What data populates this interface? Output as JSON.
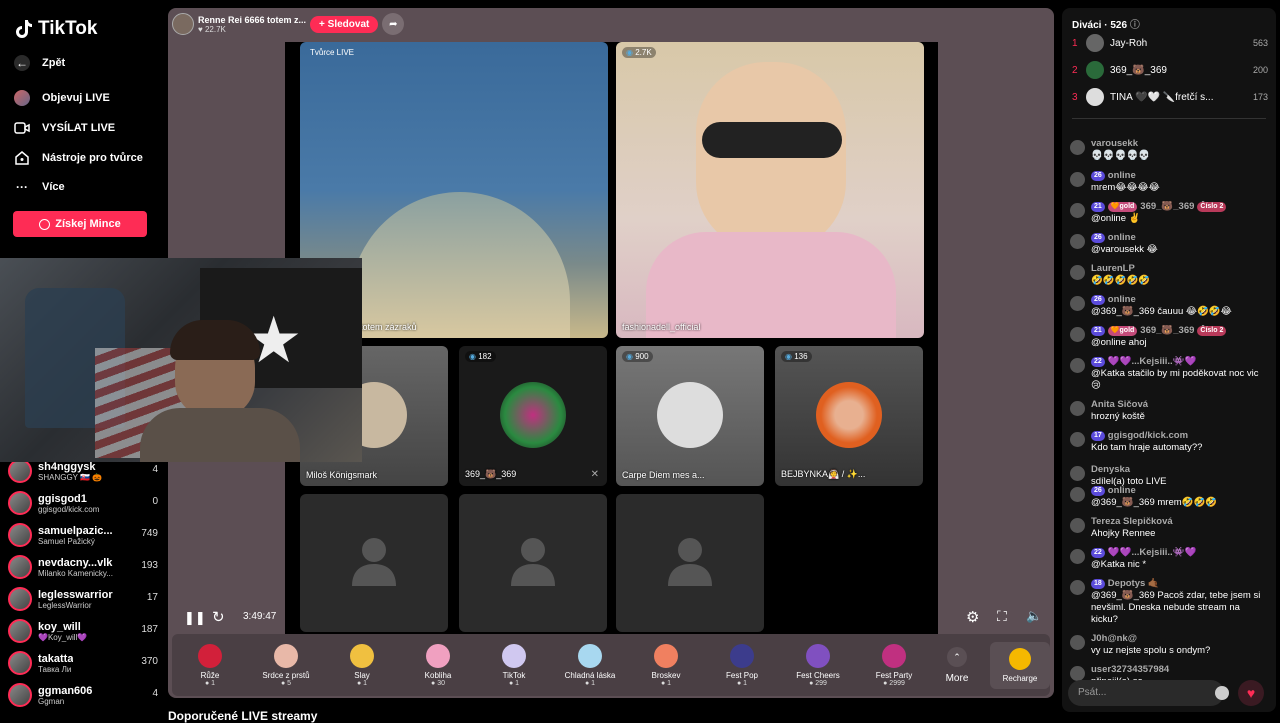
{
  "app": {
    "brand": "TikTok"
  },
  "nav": {
    "back": "Zpět",
    "items": [
      {
        "label": "Objevuj LIVE",
        "icon": "avatar"
      },
      {
        "label": "VYSÍLAT LIVE",
        "icon": "video-icon"
      },
      {
        "label": "Nástroje pro tvůrce",
        "icon": "home-icon"
      },
      {
        "label": "Více",
        "icon": "more-icon"
      }
    ],
    "coins_label": "Získej Mince"
  },
  "accounts": [
    {
      "name": "sh4nggysk",
      "sub": "SHANGGY 🇸🇰 🎃",
      "count": "4"
    },
    {
      "name": "ggisgod1",
      "sub": "ggisgod/kick.com",
      "count": "0"
    },
    {
      "name": "samuelpazic...",
      "sub": "Samuel Pažický",
      "count": "749"
    },
    {
      "name": "nevdacny...vlk",
      "sub": "Milanko Kamenicky...",
      "count": "193"
    },
    {
      "name": "leglesswarrior",
      "sub": "LeglessWarrior",
      "count": "17"
    },
    {
      "name": "koy_will",
      "sub": "💜Koy_will💜",
      "count": "187"
    },
    {
      "name": "takatta",
      "sub": "Тавка Ли",
      "count": "370"
    },
    {
      "name": "ggman606",
      "sub": "Ggman",
      "count": "4"
    }
  ],
  "host": {
    "name": "Renne Rei 6666 totem z...",
    "likes": "♥ 22.7K",
    "follow": "+ Sledovat"
  },
  "tiles": {
    "creator_badge": "Tvůrce LIVE",
    "creator_caption": "totem zázraků",
    "guest1_count": "2.7K",
    "guest1_name": "fashionadell_official",
    "small": [
      {
        "count": "",
        "name": "Miloš Königsmark"
      },
      {
        "count": "182",
        "name": "369_🐻_369"
      },
      {
        "count": "900",
        "name": "Carpe Diem mes a..."
      },
      {
        "count": "136",
        "name": "BEJBYNKA👰 / ✨..."
      }
    ]
  },
  "player": {
    "time": "3:49:47"
  },
  "gifts": [
    {
      "name": "Růže",
      "cost": "1",
      "color": "#d2203a"
    },
    {
      "name": "Srdce z prstů",
      "cost": "5",
      "color": "#e8b8a8"
    },
    {
      "name": "Slay",
      "cost": "1",
      "color": "#f0c040"
    },
    {
      "name": "Kobliha",
      "cost": "30",
      "color": "#f0a0c0"
    },
    {
      "name": "TikTok",
      "cost": "1",
      "color": "#d0c8f0"
    },
    {
      "name": "Chladná láska",
      "cost": "1",
      "color": "#a8d8f0"
    },
    {
      "name": "Broskev",
      "cost": "1",
      "color": "#f08060"
    },
    {
      "name": "Fest Pop",
      "cost": "1",
      "color": "#3c3c8c"
    },
    {
      "name": "Fest Cheers",
      "cost": "299",
      "color": "#8050c0"
    },
    {
      "name": "Fest Party",
      "cost": "2999",
      "color": "#c03080"
    }
  ],
  "gifts_more": "More",
  "recharge": "Recharge",
  "recommend": "Doporučené LIVE streamy",
  "viewers": {
    "title": "Diváci · 526",
    "top": [
      {
        "rank": "1",
        "name": "Jay-Roh",
        "val": "563"
      },
      {
        "rank": "2",
        "name": "369_🐻_369",
        "val": "200"
      },
      {
        "rank": "3",
        "name": "TINA 🖤🤍 🔪fretčí s...",
        "val": "173"
      }
    ]
  },
  "chat": [
    {
      "user": "varousekk",
      "text": "💀💀💀💀💀"
    },
    {
      "user": "online",
      "lv": "26",
      "text": "mrem😂😂😂😂"
    },
    {
      "user": "369_🐻_369",
      "lv": "21",
      "gold": "🧡gold",
      "cislo": "Číslo 2",
      "text": "@online ✌️"
    },
    {
      "user": "online",
      "lv": "26",
      "text": "@varousekk 😂"
    },
    {
      "user": "LaurenLP",
      "text": "🤣🤣🤣🤣🤣"
    },
    {
      "user": "online",
      "lv": "26",
      "text": "@369_🐻_369 čauuu 😂🤣🤣😂"
    },
    {
      "user": "369_🐻_369",
      "lv": "21",
      "gold": "🧡gold",
      "cislo": "Číslo 2",
      "text": "@online ahoj"
    },
    {
      "user": "💜💜...Kejsiii..👾💜",
      "lv": "22",
      "text": "@Katka stačilo by mi poděkovat noc vic 😢"
    },
    {
      "user": "Anita Sičová",
      "text": "hrozný koště"
    },
    {
      "user": "ggisgod/kick.com",
      "lv": "17",
      "text": "Kdo tam hraje automaty??"
    },
    {
      "user": "Denyska",
      "text": "sdílel(a) toto LIVE"
    },
    {
      "user": "online",
      "lv": "26",
      "text": "@369_🐻_369 mrem🤣🤣🤣"
    },
    {
      "user": "Tereza Slepičková",
      "text": "Ahojky Rennee"
    },
    {
      "user": "💜💜...Kejsiii..👾💜",
      "lv": "22",
      "text": "@Katka nic *"
    },
    {
      "user": "Depotys 🤙🏾",
      "lv": "18",
      "text": "@369_🐻_369 Pacoš zdar, tebe jsem si nevšiml. Dneska nebude stream na kicku?"
    },
    {
      "user": "J0h@nk@",
      "text": "vy uz nejste spolu s ondym?"
    },
    {
      "user": "user32734357984",
      "text": "připojil(a) se"
    }
  ],
  "chat_placeholder": "Psát..."
}
